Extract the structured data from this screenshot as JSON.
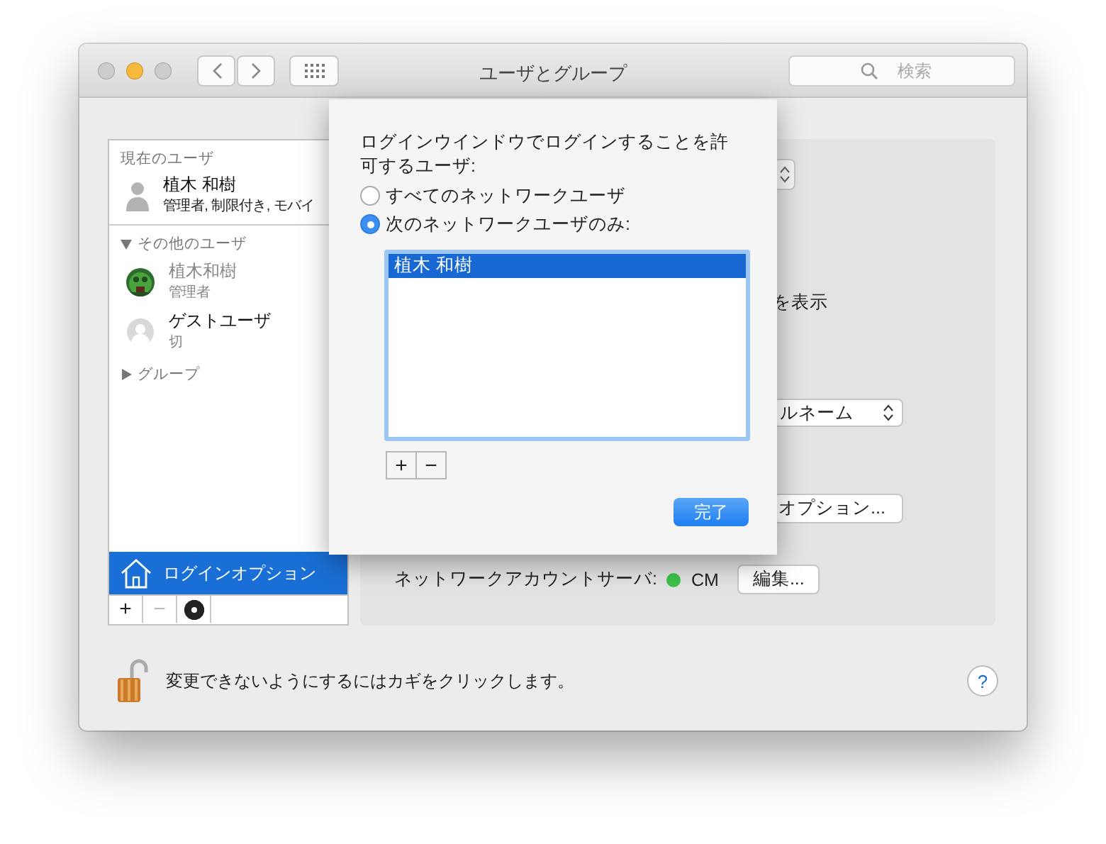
{
  "window": {
    "title": "ユーザとグループ",
    "traffic_lights": [
      {
        "color": "#cdcdcd"
      },
      {
        "color": "#f6b93b"
      },
      {
        "color": "#cdcdcd"
      }
    ],
    "search": {
      "placeholder": "検索"
    }
  },
  "sidebar": {
    "current_header": "現在のユーザ",
    "current_users": [
      {
        "name": "植木 和樹",
        "detail": "管理者, 制限付き, モバイ",
        "kind": "silhouette",
        "disabled": false,
        "selected": false
      }
    ],
    "other_users": {
      "label": "その他のユーザ",
      "expanded": true,
      "users": [
        {
          "name": "植木和樹",
          "detail": "管理者",
          "kind": "picture",
          "disabled": true,
          "selected": false
        },
        {
          "name": "ゲストユーザ",
          "detail": "切",
          "kind": "guest",
          "disabled": false,
          "selected": false
        }
      ]
    },
    "groups": {
      "label": "グループ",
      "expanded": false
    },
    "login_options": {
      "label": "ログインオプション",
      "selected": true
    },
    "toolbar": [
      {
        "kind": "add",
        "label": "+",
        "disabled": false
      },
      {
        "kind": "remove",
        "label": "−",
        "disabled": true
      },
      {
        "kind": "gear",
        "disabled": false
      }
    ]
  },
  "panel": {
    "display_text": "を表示",
    "popup_value": "ルネーム",
    "options_button": "オプション...",
    "network_server": {
      "label": "ネットワークアカウントサーバ:",
      "status": {
        "color": "#3cc24a"
      },
      "value": "CM",
      "button": "編集..."
    }
  },
  "sheet": {
    "prompt": "ログインウインドウでログインすることを許可するユーザ:",
    "radios": [
      {
        "label": "すべてのネットワークユーザ",
        "selected": false
      },
      {
        "label": "次のネットワークユーザのみ:",
        "selected": true
      }
    ],
    "list": [
      {
        "name": "植木 和樹",
        "selected": true
      }
    ],
    "list_buttons": [
      {
        "label": "+",
        "disabled": false
      },
      {
        "label": "−",
        "disabled": false
      }
    ],
    "done_button": "完了"
  },
  "footer": {
    "lock_text": "変更できないようにするにはカギをクリックします。",
    "locked": false,
    "help": "?"
  }
}
